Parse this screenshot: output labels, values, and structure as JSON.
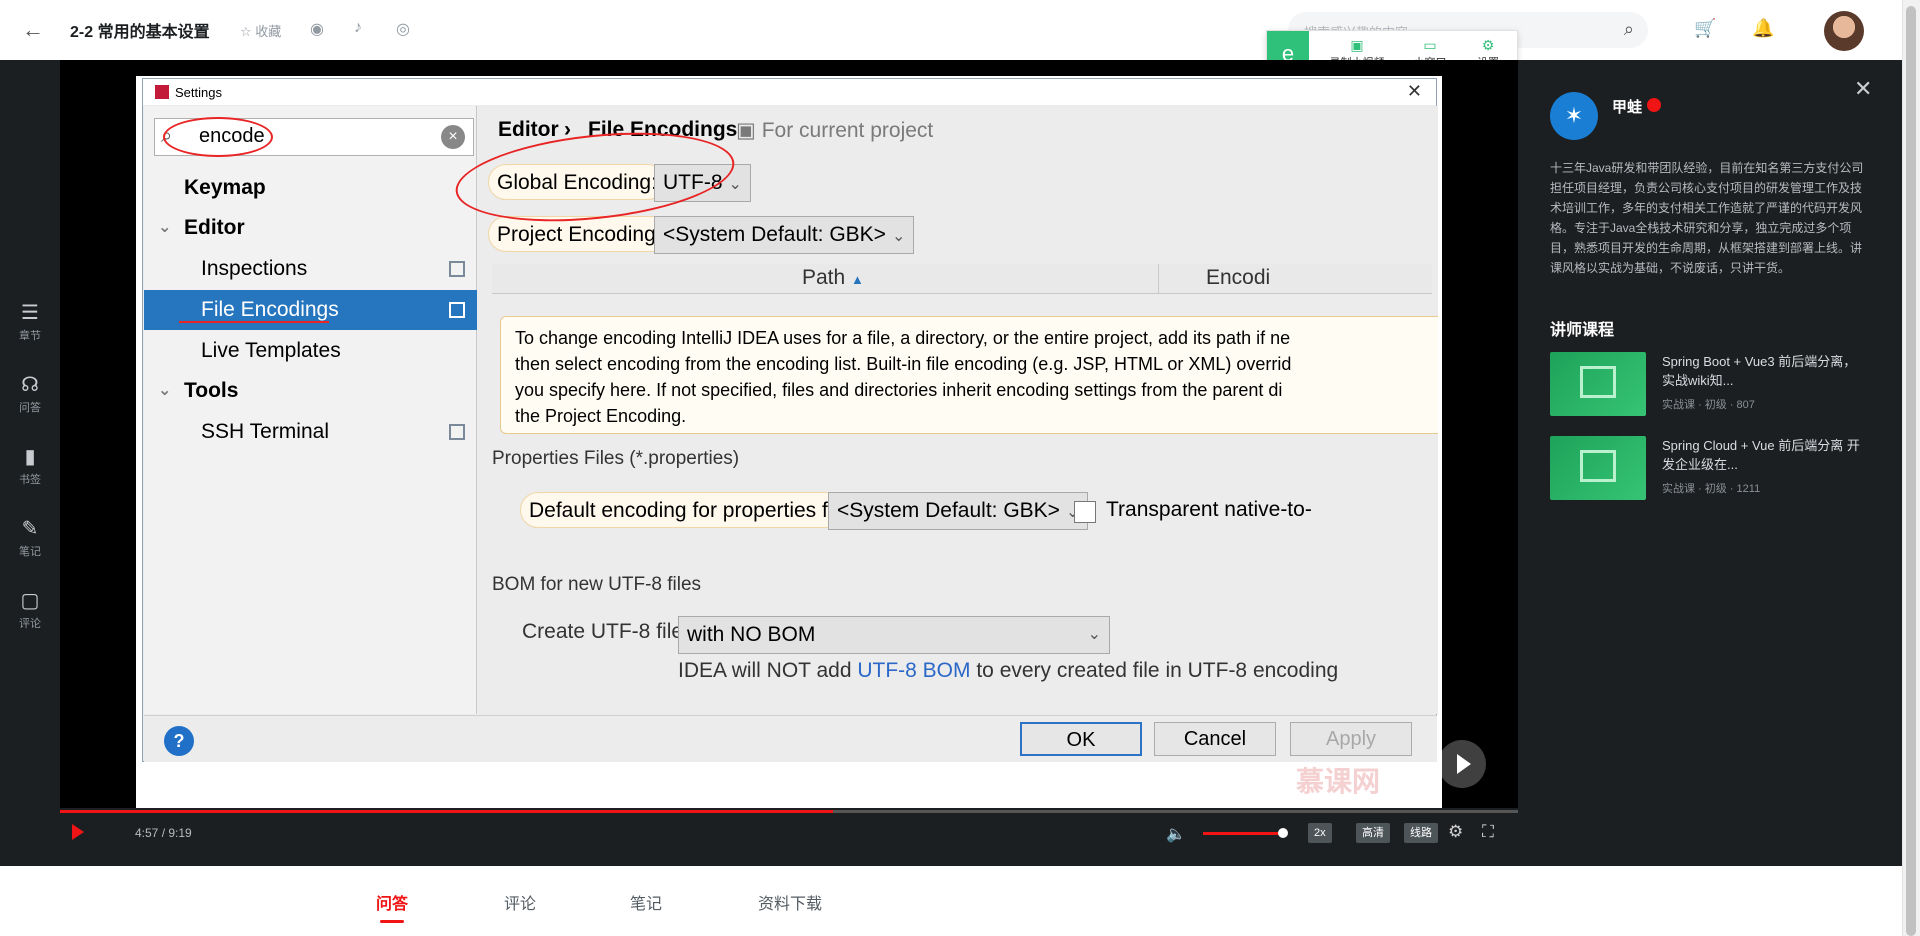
{
  "topbar": {
    "back_icon": "arrow-left-icon",
    "title": "2-2 常用的基本设置",
    "favorite_label": "收藏",
    "search_placeholder": "搜索感兴趣的内容",
    "recorder": {
      "record_label": "录制小视频",
      "mini_window_label": "小窗口",
      "settings_label": "设置"
    }
  },
  "left_sidebar": {
    "items": [
      {
        "label": "章节",
        "icon": "chapter-list-icon"
      },
      {
        "label": "问答",
        "icon": "qa-icon"
      },
      {
        "label": "书签",
        "icon": "bookmark-icon"
      },
      {
        "label": "笔记",
        "icon": "pen-icon"
      },
      {
        "label": "评论",
        "icon": "comment-icon"
      }
    ]
  },
  "player": {
    "time": "4:57 / 9:19",
    "progress": 0.53,
    "volume": 0.85,
    "speed_label": "2x",
    "quality_label": "高清",
    "line_label": "线路",
    "watermark": "慕课网"
  },
  "ide_dialog": {
    "window_title": "Settings",
    "search_value": "encode",
    "tree": [
      {
        "label": "Keymap",
        "bold": true
      },
      {
        "label": "Editor",
        "bold": true
      },
      {
        "label": "Inspections"
      },
      {
        "label": "File Encodings",
        "selected": true
      },
      {
        "label": "Live Templates"
      },
      {
        "label": "Tools",
        "bold": true
      },
      {
        "label": "SSH Terminal"
      }
    ],
    "breadcrumb": {
      "parent": "Editor",
      "separator": "›",
      "current": "File Encodings",
      "scope": "For current project"
    },
    "global_encoding_label": "Global Encoding:",
    "global_encoding_value": "UTF-8",
    "project_encoding_label": "Project Encoding:",
    "project_encoding_value": "<System Default: GBK>",
    "table_headers": {
      "path": "Path",
      "encoding": "Encodi"
    },
    "tooltip_lines": [
      "To change encoding IntelliJ IDEA uses for a file, a directory, or the entire project, add its path if ne",
      "then select encoding from the encoding list. Built-in file encoding (e.g. JSP, HTML or XML) overrid",
      "you specify here. If not specified, files and directories inherit encoding settings from the parent di",
      "the Project Encoding."
    ],
    "properties_section": "Properties Files (*.properties)",
    "default_props_label": "Default encoding for properties files:",
    "default_props_value": "<System Default: GBK>",
    "transparent_label": "Transparent native-to-",
    "bom_section": "BOM for new UTF-8 files",
    "create_utf8_label": "Create UTF-8 files:",
    "create_utf8_value": "with NO BOM",
    "bom_note_prefix": "IDEA will NOT add ",
    "bom_note_link": "UTF-8 BOM",
    "bom_note_suffix": " to every created file in UTF-8 encoding",
    "buttons": {
      "ok": "OK",
      "cancel": "Cancel",
      "apply": "Apply",
      "help": "?"
    }
  },
  "right_panel": {
    "teacher_name": "甲蛙",
    "bio": "十三年Java研发和带团队经验，目前在知名第三方支付公司担任项目经理，负责公司核心支付项目的研发管理工作及技术培训工作，多年的支付相关工作造就了严谨的代码开发风格。专注于Java全栈技术研究和分享，独立完成过多个项目，熟悉项目开发的生命周期，从框架搭建到部署上线。讲课风格以实战为基础，不说废话，只讲干货。",
    "courses_title": "讲师课程",
    "courses": [
      {
        "title": "Spring Boot + Vue3 前后端分离，实战wiki知...",
        "meta": "实战课 · 初级 · 807"
      },
      {
        "title": "Spring Cloud + Vue 前后端分离 开发企业级在...",
        "meta": "实战课 · 初级 · 1211"
      }
    ]
  },
  "bottom_tabs": [
    {
      "label": "问答",
      "active": true
    },
    {
      "label": "评论"
    },
    {
      "label": "笔记"
    },
    {
      "label": "资料下载"
    }
  ]
}
